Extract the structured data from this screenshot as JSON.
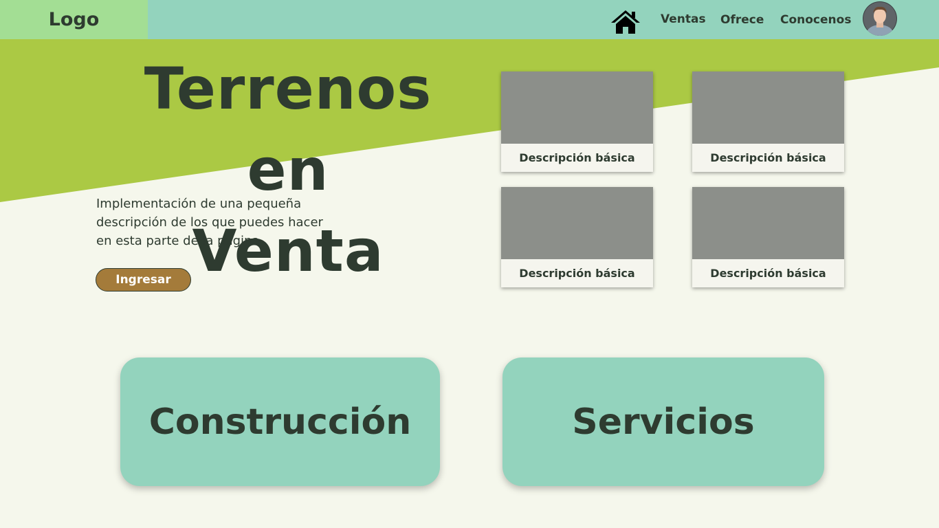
{
  "header": {
    "logo": "Logo",
    "nav": {
      "home_icon": "home-icon",
      "ventas": "Ventas",
      "ofrece": "Ofrece",
      "conocenos": "Conocenos"
    },
    "avatar_icon": "user-avatar"
  },
  "hero": {
    "title_line1": "Terrenos en",
    "title_line2": "Venta",
    "description": "Implementación de una pequeña descripción de los que puedes hacer en esta parte de la pagina",
    "button_label": "Ingresar"
  },
  "cards": [
    {
      "label": "Descripción básica"
    },
    {
      "label": "Descripción básica"
    },
    {
      "label": "Descripción básica"
    },
    {
      "label": "Descripción básica"
    }
  ],
  "tiles": {
    "construccion": "Construcción",
    "servicios": "Servicios"
  },
  "colors": {
    "header_bg": "#93d3bd",
    "logo_bg": "#a3de94",
    "band_green": "#abc944",
    "page_bg": "#f5f7ec",
    "text_dark": "#2e3b30",
    "button_bg": "#a47b3a",
    "card_image": "#8c8f8a",
    "tile_bg": "#93d3bd"
  }
}
